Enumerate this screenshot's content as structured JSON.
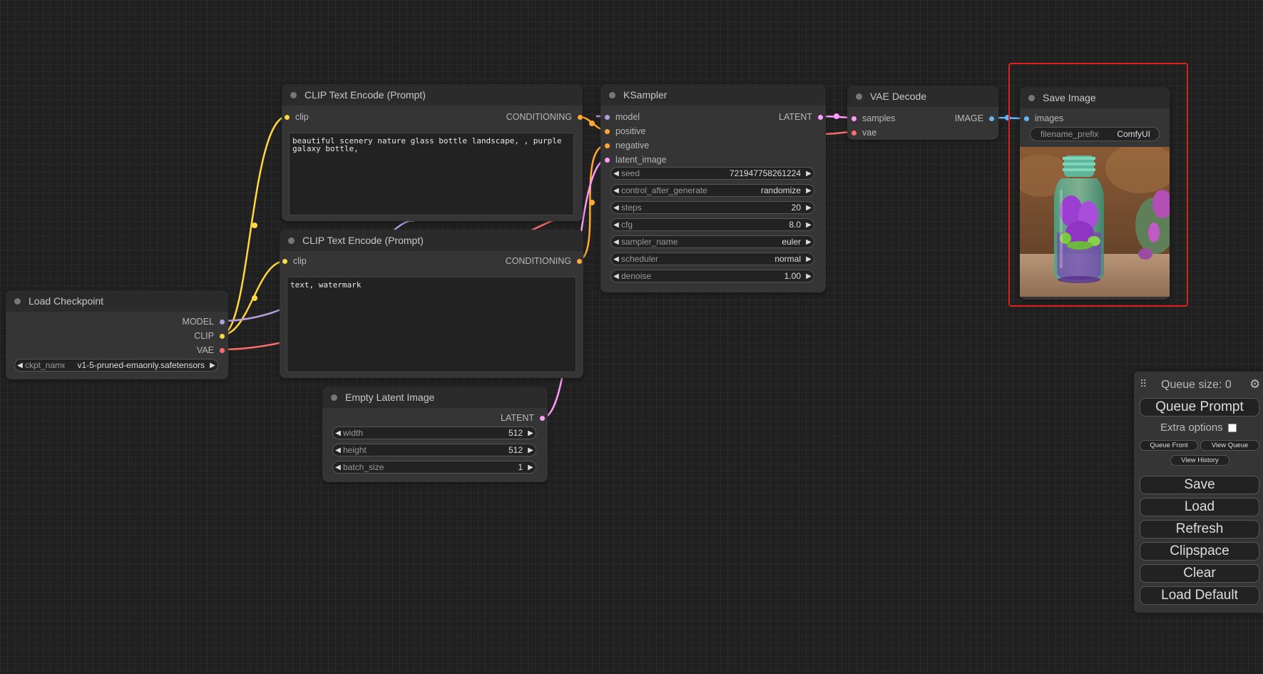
{
  "colors": {
    "model": "#b39ddb",
    "clip": "#ffd740",
    "vae": "#ff6e6e",
    "conditioning": "#ffa931",
    "latent": "#ff9cf9",
    "image": "#64b5f6",
    "highlight": "#e11d1d"
  },
  "nodes": {
    "clip_pos": {
      "title": "CLIP Text Encode (Prompt)",
      "input_clip": "clip",
      "output": "CONDITIONING",
      "text": "beautiful scenery nature glass bottle landscape, , purple galaxy bottle,"
    },
    "clip_neg": {
      "title": "CLIP Text Encode (Prompt)",
      "input_clip": "clip",
      "output": "CONDITIONING",
      "text": "text, watermark"
    },
    "ksampler": {
      "title": "KSampler",
      "inputs": [
        "model",
        "positive",
        "negative",
        "latent_image"
      ],
      "output": "LATENT",
      "widgets": [
        {
          "label": "seed",
          "value": "721947758261224"
        },
        {
          "label": "control_after_generate",
          "value": "randomize"
        },
        {
          "label": "steps",
          "value": "20"
        },
        {
          "label": "cfg",
          "value": "8.0"
        },
        {
          "label": "sampler_name",
          "value": "euler"
        },
        {
          "label": "scheduler",
          "value": "normal"
        },
        {
          "label": "denoise",
          "value": "1.00"
        }
      ]
    },
    "vae_decode": {
      "title": "VAE Decode",
      "inputs": [
        "samples",
        "vae"
      ],
      "output": "IMAGE"
    },
    "save_image": {
      "title": "Save Image",
      "input": "images",
      "filename_prefix_label": "filename_prefix",
      "filename_prefix_value": "ComfyUI"
    },
    "load_checkpoint": {
      "title": "Load Checkpoint",
      "outputs": [
        "MODEL",
        "CLIP",
        "VAE"
      ],
      "ckpt_label": "ckpt_name",
      "ckpt_value": "v1-5-pruned-emaonly.safetensors"
    },
    "empty_latent": {
      "title": "Empty Latent Image",
      "output": "LATENT",
      "widgets": [
        {
          "label": "width",
          "value": "512"
        },
        {
          "label": "height",
          "value": "512"
        },
        {
          "label": "batch_size",
          "value": "1"
        }
      ]
    }
  },
  "queue_panel": {
    "queue_size_label": "Queue size: 0",
    "queue_prompt": "Queue Prompt",
    "extra_options": "Extra options",
    "queue_front": "Queue Front",
    "view_queue": "View Queue",
    "view_history": "View History",
    "save": "Save",
    "load": "Load",
    "refresh": "Refresh",
    "clipspace": "Clipspace",
    "clear": "Clear",
    "load_default": "Load Default",
    "drag_handle_icon": "drag-handle-icon",
    "settings_icon": "gear-icon"
  }
}
